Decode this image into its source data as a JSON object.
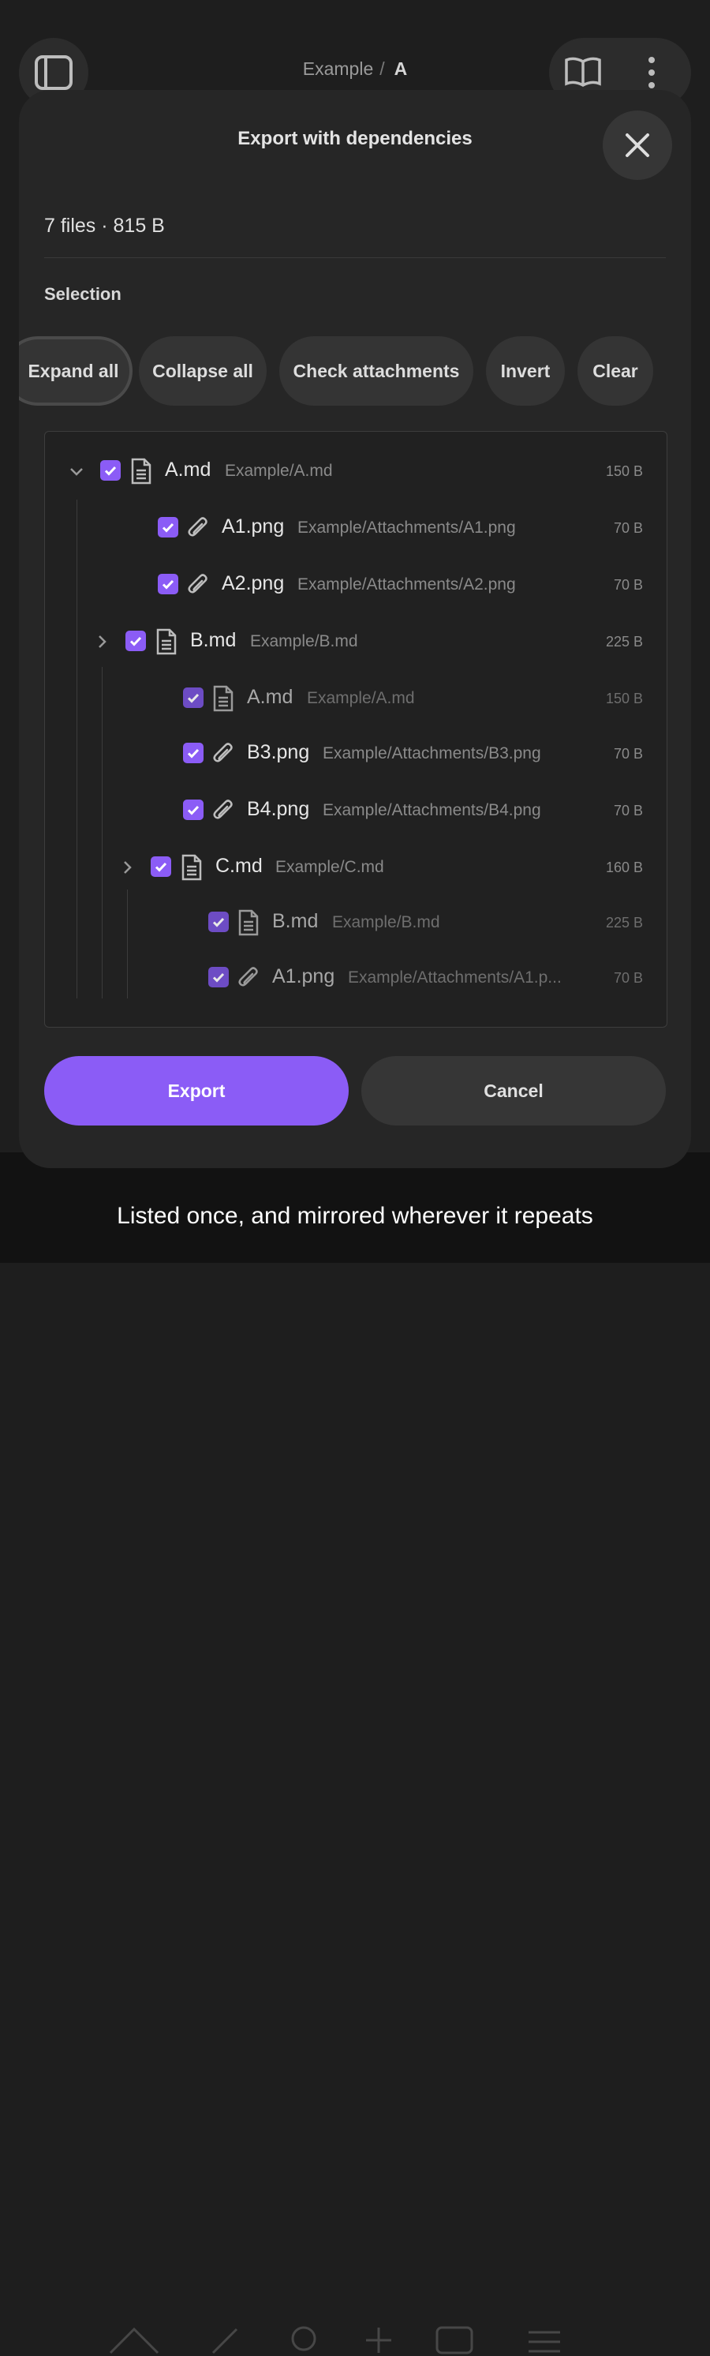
{
  "header": {
    "breadcrumb_parent": "Example",
    "breadcrumb_sep": "/",
    "breadcrumb_current": "A"
  },
  "dialog": {
    "title": "Export with dependencies",
    "summary": "7 files · 815 B",
    "selection_label": "Selection",
    "chips": {
      "expand_all": "Expand all",
      "collapse_all": "Collapse all",
      "check_attachments": "Check attachments",
      "invert": "Invert",
      "clear": "Clear"
    },
    "tree": [
      {
        "name": "A.md",
        "path": "Example/A.md",
        "size": "150 B",
        "icon": "file-icon"
      },
      {
        "name": "A1.png",
        "path": "Example/Attachments/A1.png",
        "size": "70 B",
        "icon": "attachment-icon"
      },
      {
        "name": "A2.png",
        "path": "Example/Attachments/A2.png",
        "size": "70 B",
        "icon": "attachment-icon"
      },
      {
        "name": "B.md",
        "path": "Example/B.md",
        "size": "225 B",
        "icon": "file-icon"
      },
      {
        "name": "A.md",
        "path": "Example/A.md",
        "size": "150 B",
        "icon": "file-icon"
      },
      {
        "name": "B3.png",
        "path": "Example/Attachments/B3.png",
        "size": "70 B",
        "icon": "attachment-icon"
      },
      {
        "name": "B4.png",
        "path": "Example/Attachments/B4.png",
        "size": "70 B",
        "icon": "attachment-icon"
      },
      {
        "name": "C.md",
        "path": "Example/C.md",
        "size": "160 B",
        "icon": "file-icon"
      },
      {
        "name": "B.md",
        "path": "Example/B.md",
        "size": "225 B",
        "icon": "file-icon"
      },
      {
        "name": "A1.png",
        "path": "Example/Attachments/A1.p...",
        "size": "70 B",
        "icon": "attachment-icon"
      }
    ],
    "export_label": "Export",
    "cancel_label": "Cancel"
  },
  "caption": "Listed once, and mirrored wherever it repeats",
  "colors": {
    "accent": "#8b5cf6",
    "surface": "#262626"
  }
}
